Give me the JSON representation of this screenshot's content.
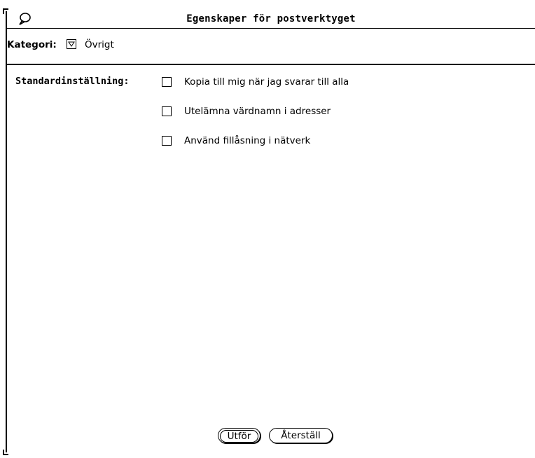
{
  "window": {
    "title": "Egenskaper för postverktyget"
  },
  "category": {
    "label": "Kategori:",
    "value": "Övrigt"
  },
  "settings": {
    "label": "Standardinställning:",
    "options": [
      {
        "label": "Kopia till mig när jag svarar till alla",
        "checked": false
      },
      {
        "label": "Utelämna värdnamn i adresser",
        "checked": false
      },
      {
        "label": "Använd fillåsning i nätverk",
        "checked": false
      }
    ]
  },
  "buttons": {
    "apply": "Utför",
    "reset": "Återställ"
  },
  "icons": {
    "window_menu": "window-menu-icon",
    "category_menu": "menu-triangle-icon"
  }
}
